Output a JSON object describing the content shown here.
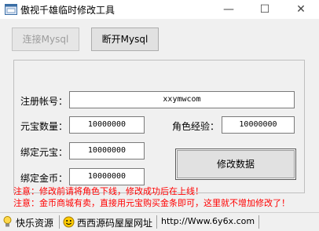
{
  "window": {
    "title": "傲视千雄临时修改工具",
    "minimize_glyph": "—",
    "maximize_glyph": "☐",
    "close_glyph": "✕",
    "icon": "app-icon"
  },
  "toolbar": {
    "connect_label": "连接Mysql",
    "disconnect_label": "断开Mysql"
  },
  "form": {
    "account_label": "注册帐号：",
    "account_value": "xxymwcom",
    "yuanbao_label": "元宝数量：",
    "yuanbao_value": "10000000",
    "exp_label": "角色经验：",
    "exp_value": "10000000",
    "bound_yuanbao_label": "绑定元宝：",
    "bound_yuanbao_value": "10000000",
    "bound_gold_label": "绑定金币：",
    "bound_gold_value": "10000000",
    "modify_label": "修改数据"
  },
  "notices": {
    "line1": "注意：修改前请将角色下线，修改成功后在上线！",
    "line2": "注意：金币商城有卖，直接用元宝购买金条即可，这里就不增加修改了！"
  },
  "statusbar": {
    "item1": "快乐资源",
    "item2": "西西源码屋屋网址",
    "item3": "http://Www.6y6x.com",
    "item1_icon": "lightbulb-icon",
    "item2_icon": "smiley-icon"
  },
  "colors": {
    "notice": "#ff0000",
    "background": "#f0f0f0"
  }
}
